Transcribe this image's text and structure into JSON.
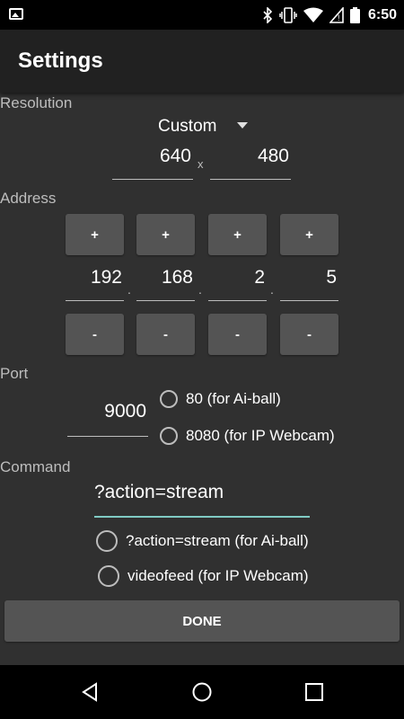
{
  "status_bar": {
    "time": "6:50",
    "icons": [
      "image-icon",
      "bluetooth-icon",
      "vibrate-icon",
      "wifi-icon",
      "signal-icon",
      "battery-icon"
    ]
  },
  "app_bar": {
    "title": "Settings"
  },
  "resolution": {
    "label": "Resolution",
    "preset": "Custom",
    "width": "640",
    "separator": "x",
    "height": "480"
  },
  "address": {
    "label": "Address",
    "plus_label": "+",
    "minus_label": "-",
    "octets": [
      "192",
      "168",
      "2",
      "5"
    ],
    "dot": "."
  },
  "port": {
    "label": "Port",
    "value": "9000",
    "options": [
      "80 (for Ai-ball)",
      "8080 (for IP Webcam)"
    ]
  },
  "command": {
    "label": "Command",
    "value": "?action=stream",
    "options": [
      "?action=stream (for Ai-ball)",
      "videofeed (for IP Webcam)"
    ]
  },
  "done_label": "DONE",
  "colors": {
    "background": "#303030",
    "appbar": "#212121",
    "button": "#545454",
    "accent": "#80cbc4"
  }
}
